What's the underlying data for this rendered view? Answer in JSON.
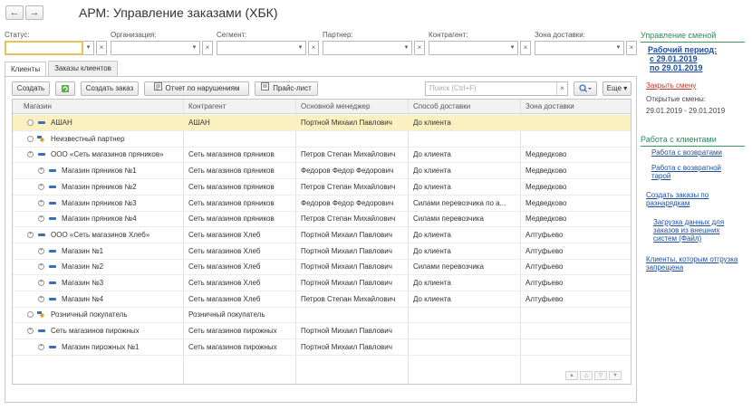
{
  "window": {
    "title": "АРМ: Управление заказами (ХБК)"
  },
  "nav": {
    "back": "←",
    "forward": "→"
  },
  "filters": [
    {
      "label": "Статус:",
      "value": ""
    },
    {
      "label": "Организация:",
      "value": ""
    },
    {
      "label": "Сегмент:",
      "value": ""
    },
    {
      "label": "Партнер:",
      "value": ""
    },
    {
      "label": "Контрагент:",
      "value": ""
    },
    {
      "label": "Зона доставки:",
      "value": ""
    }
  ],
  "tabs": [
    "Клиенты",
    "Заказы клиентов"
  ],
  "toolbar": {
    "create": "Создать",
    "create_order": "Создать заказ",
    "violations_report": "Отчет по нарушениям",
    "price_list": "Прайс-лист",
    "search_placeholder": "Поиск (Ctrl+F)",
    "more": "Еще"
  },
  "columns": [
    "Магазин",
    "Контрагент",
    "Основной менеджер",
    "Способ доставки",
    "Зона доставки"
  ],
  "rows": [
    {
      "level": 0,
      "kind": "client",
      "selected": true,
      "shop": "АШАН",
      "counterparty": "АШАН",
      "manager": "Портной Михаил Павлович",
      "delivery": "До клиента",
      "zone": ""
    },
    {
      "level": 0,
      "kind": "partner",
      "selected": false,
      "shop": "Неизвестный партнер",
      "counterparty": "",
      "manager": "",
      "delivery": "",
      "zone": ""
    },
    {
      "level": 0,
      "kind": "group",
      "selected": false,
      "shop": "ООО «Сеть магазинов пряников»",
      "counterparty": "Сеть магазинов пряников",
      "manager": "Петров Степан Михайлович",
      "delivery": "До клиента",
      "zone": "Медведково"
    },
    {
      "level": 1,
      "kind": "client",
      "selected": false,
      "shop": "Магазин пряников №1",
      "counterparty": "Сеть магазинов пряников",
      "manager": "Федоров Федор Федорович",
      "delivery": "До клиента",
      "zone": "Медведково"
    },
    {
      "level": 1,
      "kind": "client",
      "selected": false,
      "shop": "Магазин пряников №2",
      "counterparty": "Сеть магазинов пряников",
      "manager": "Петров Степан Михайлович",
      "delivery": "До клиента",
      "zone": "Медведково"
    },
    {
      "level": 1,
      "kind": "client",
      "selected": false,
      "shop": "Магазин пряников №3",
      "counterparty": "Сеть магазинов пряников",
      "manager": "Федоров Федор Федорович",
      "delivery": "Силами перевозчика по а...",
      "zone": "Медведково"
    },
    {
      "level": 1,
      "kind": "client",
      "selected": false,
      "shop": "Магазин пряников №4",
      "counterparty": "Сеть магазинов пряников",
      "manager": "Петров Степан Михайлович",
      "delivery": "Силами перевозчика",
      "zone": "Медведково"
    },
    {
      "level": 0,
      "kind": "group",
      "selected": false,
      "shop": "ООО «Сеть магазинов Хлеб»",
      "counterparty": "Сеть магазинов Хлеб",
      "manager": "Портной Михаил Павлович",
      "delivery": "До клиента",
      "zone": "Алтуфьево"
    },
    {
      "level": 1,
      "kind": "client",
      "selected": false,
      "shop": "Магазин №1",
      "counterparty": "Сеть магазинов Хлеб",
      "manager": "Портной Михаил Павлович",
      "delivery": "До клиента",
      "zone": "Алтуфьево"
    },
    {
      "level": 1,
      "kind": "client",
      "selected": false,
      "shop": "Магазин №2",
      "counterparty": "Сеть магазинов Хлеб",
      "manager": "Портной Михаил Павлович",
      "delivery": "Силами перевозчика",
      "zone": "Алтуфьево"
    },
    {
      "level": 1,
      "kind": "client",
      "selected": false,
      "shop": "Магазин №3",
      "counterparty": "Сеть магазинов Хлеб",
      "manager": "Портной Михаил Павлович",
      "delivery": "До клиента",
      "zone": "Алтуфьево"
    },
    {
      "level": 1,
      "kind": "client",
      "selected": false,
      "shop": "Магазин №4",
      "counterparty": "Сеть магазинов Хлеб",
      "manager": "Петров Степан Михайлович",
      "delivery": "До клиента",
      "zone": "Алтуфьево"
    },
    {
      "level": 0,
      "kind": "partner",
      "selected": false,
      "shop": "Розничный покупатель",
      "counterparty": "Розничный покупатель",
      "manager": "",
      "delivery": "",
      "zone": ""
    },
    {
      "level": 0,
      "kind": "group",
      "selected": false,
      "shop": "Сеть магазинов пирожных",
      "counterparty": "Сеть магазинов пирожных",
      "manager": "Портной Михаил Павлович",
      "delivery": "",
      "zone": ""
    },
    {
      "level": 1,
      "kind": "client",
      "selected": false,
      "shop": "Магазин пирожных №1",
      "counterparty": "Сеть магазинов пирожных",
      "manager": "Портной Михаил Павлович",
      "delivery": "",
      "zone": ""
    }
  ],
  "right_panel": {
    "shift_title": "Управление сменой",
    "work_period_line1": "Рабочий период:",
    "work_period_line2": "с 29.01.2019",
    "work_period_line3": "по 29.01.2019",
    "close_shift": "Закрыть смену",
    "open_shifts_label": "Открытые смены:",
    "open_shifts_value": "29.01.2019 - 29.01.2019",
    "clients_title": "Работа с клиентами",
    "returns_line1": "Работа с возвратами",
    "returns_tare_line1": "Работа с возвратной",
    "returns_tare_line2": "тарой",
    "create_orders_line1": "Создать заказы по",
    "create_orders_line2": "разнарядкам",
    "load_data_line1": "Загрузка данных для",
    "load_data_line2": "заказов из внешних",
    "load_data_line3": "систем (Файл)",
    "blocked_line1": "Клиенты, которым отгрузка",
    "blocked_line2": "запрещена"
  },
  "colors": {
    "accent_green": "#2e8b57",
    "link_blue": "#1f4fa0",
    "selected_row": "#fbf0bf",
    "focus_border": "#e6c35a"
  }
}
